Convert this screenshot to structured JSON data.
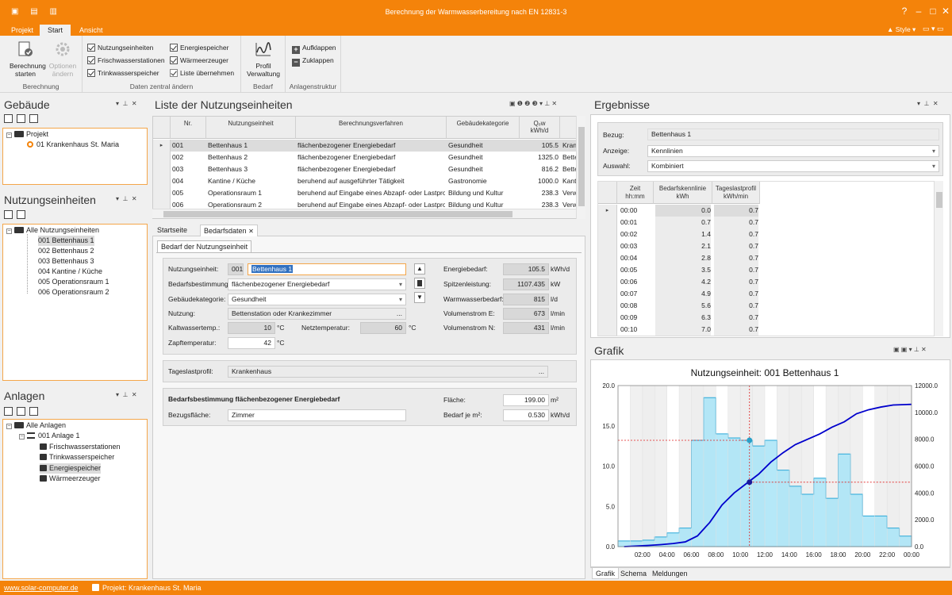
{
  "app": {
    "title": "Berechnung der Warmwasserbereitung nach EN 12831-3",
    "style_label": "Style"
  },
  "menu": {
    "tabs": [
      "Projekt",
      "Start",
      "Ansicht"
    ]
  },
  "ribbon": {
    "groups": [
      "Berechnung",
      "Daten zentral ändern",
      "Bedarf",
      "Anlagenstruktur"
    ],
    "berechnung_starten": "Berechnung starten",
    "optionen": "Optionen ändern",
    "daten_items": [
      "Nutzungseinheiten",
      "Frischwasserstationen",
      "Trinkwasserspeicher",
      "Energiespeicher",
      "Wärmeerzeuger",
      "Liste übernehmen"
    ],
    "profil": "Profil Verwaltung",
    "aufklappen": "Aufklappen",
    "zuklappen": "Zuklappen"
  },
  "gebaeude": {
    "title": "Gebäude",
    "tree": [
      "Projekt",
      "01 Krankenhaus St. Maria"
    ]
  },
  "nutzungseinheiten": {
    "title": "Nutzungseinheiten",
    "tree": [
      "Alle Nutzungseinheiten",
      "001 Bettenhaus 1",
      "002 Bettenhaus 2",
      "003 Bettenhaus 3",
      "004 Kantine / Küche",
      "005 Operationsraum 1",
      "006 Operationsraum 2"
    ]
  },
  "anlagen": {
    "title": "Anlagen",
    "tree": [
      "Alle Anlagen",
      "001 Anlage 1",
      "Frischwasserstationen",
      "Trinkwasserspeicher",
      "Energiespeicher",
      "Wärmeerzeuger"
    ]
  },
  "liste": {
    "title": "Liste der Nutzungseinheiten",
    "pager": [
      "1",
      "2",
      "3"
    ],
    "headers": [
      "Nr.",
      "Nutzungseinheit",
      "Berechnungsverfahren",
      "Gebäudekategorie",
      "Qₑw\nkWh/d"
    ],
    "rows": [
      [
        "001",
        "Bettenhaus 1",
        "flächenbezogener Energiebedarf",
        "Gesundheit",
        "105.5",
        "Krank"
      ],
      [
        "002",
        "Bettenhaus 2",
        "flächenbezogener Energiebedarf",
        "Gesundheit",
        "1325.0",
        "Bette"
      ],
      [
        "003",
        "Bettenhaus 3",
        "flächenbezogener Energiebedarf",
        "Gesundheit",
        "816.2",
        "Bette"
      ],
      [
        "004",
        "Kantine / Küche",
        "beruhend auf ausgeführter Tätigkeit",
        "Gastronomie",
        "1000.0",
        "Kanti"
      ],
      [
        "005",
        "Operationsraum 1",
        "beruhend auf Eingabe eines Abzapf- oder Lastprofils",
        "Bildung und Kultur",
        "238.3",
        "Verw"
      ],
      [
        "006",
        "Operationsraum 2",
        "beruhend auf Eingabe eines Abzapf- oder Lastprofils",
        "Bildung und Kultur",
        "238.3",
        "Verw"
      ]
    ]
  },
  "doc_tabs": [
    "Startseite",
    "Bedarfsdaten"
  ],
  "bedarf": {
    "subtab": "Bedarf der Nutzungseinheit",
    "nutzungseinheit_label": "Nutzungseinheit:",
    "nutzungseinheit_nr": "001",
    "nutzungseinheit_name": "Bettenhaus 1",
    "bedarfsbestimmung_label": "Bedarfsbestimmung:",
    "bedarfsbestimmung": "flächenbezogener Energiebedarf",
    "gebaeudekategorie_label": "Gebäudekategorie:",
    "gebaeudekategorie": "Gesundheit",
    "nutzung_label": "Nutzung:",
    "nutzung": "Bettenstation oder Krankezimmer",
    "kaltwasser_label": "Kaltwassertemp.:",
    "kaltwasser": "10",
    "netz_label": "Netztemperatur:",
    "netz": "60",
    "zapf_label": "Zapftemperatur:",
    "zapf": "42",
    "celsius": "°C",
    "energiebedarf_label": "Energiebedarf:",
    "energiebedarf": "105.5",
    "energiebedarf_unit": "kWh/d",
    "spitzen_label": "Spitzenleistung:",
    "spitzen": "1107.435",
    "spitzen_unit": "kW",
    "wwbedarf_label": "Warmwasserbedarf:",
    "wwbedarf": "815",
    "wwbedarf_unit": "l/d",
    "volE_label": "Volumenstrom E:",
    "volE": "673",
    "volN_label": "Volumenstrom N:",
    "volN": "431",
    "vol_unit": "l/min",
    "tageslast_label": "Tageslastprofil:",
    "tageslast": "Krankenhaus",
    "sect_title": "Bedarfsbestimmung flächenbezogener Energiebedarf",
    "bezug_label": "Bezugsfläche:",
    "bezug": "Zimmer",
    "flaeche_label": "Fläche:",
    "flaeche": "199.00",
    "flaeche_unit": "m²",
    "bedarfjem2_label": "Bedarf je m²:",
    "bedarfjem2": "0.530",
    "bedarfjem2_unit": "kWh/d"
  },
  "ergebnisse": {
    "title": "Ergebnisse",
    "bezug_label": "Bezug:",
    "bezug": "Bettenhaus 1",
    "anzeige_label": "Anzeige:",
    "anzeige": "Kennlinien",
    "auswahl_label": "Auswahl:",
    "auswahl": "Kombiniert",
    "headers": [
      "Zeit\nhh:mm",
      "Bedarfskennlinie\nkWh",
      "Tageslastprofil\nkWh/min"
    ],
    "rows": [
      [
        "00:00",
        "0.0",
        "0.7"
      ],
      [
        "00:01",
        "0.7",
        "0.7"
      ],
      [
        "00:02",
        "1.4",
        "0.7"
      ],
      [
        "00:03",
        "2.1",
        "0.7"
      ],
      [
        "00:04",
        "2.8",
        "0.7"
      ],
      [
        "00:05",
        "3.5",
        "0.7"
      ],
      [
        "00:06",
        "4.2",
        "0.7"
      ],
      [
        "00:07",
        "4.9",
        "0.7"
      ],
      [
        "00:08",
        "5.6",
        "0.7"
      ],
      [
        "00:09",
        "6.3",
        "0.7"
      ],
      [
        "00:10",
        "7.0",
        "0.7"
      ]
    ]
  },
  "grafik": {
    "title": "Grafik",
    "tabs": [
      "Grafik",
      "Schema",
      "Meldungen"
    ]
  },
  "chart_data": {
    "type": "area",
    "title": "Nutzungseinheit: 001 Bettenhaus 1",
    "x_ticks": [
      "02:00",
      "04:00",
      "06:00",
      "08:00",
      "10:00",
      "12:00",
      "14:00",
      "16:00",
      "18:00",
      "20:00",
      "22:00",
      "00:00"
    ],
    "y_left_ticks": [
      "0.0",
      "5.0",
      "10.0",
      "15.0",
      "20.0"
    ],
    "y_right_ticks": [
      "0.0",
      "2000.0",
      "4000.0",
      "6000.0",
      "8000.0",
      "10000.0",
      "12000.0"
    ],
    "ylim_left": [
      0,
      20
    ],
    "ylim_right": [
      0,
      12000
    ],
    "xlim_hours": [
      0,
      24
    ],
    "series": [
      {
        "values_hourly": [
          0.7,
          0.7,
          0.8,
          1.2,
          1.7,
          2.3,
          13.2,
          18.5,
          14,
          13.5,
          13.2,
          12.5,
          13.2,
          9.5,
          7.5,
          6.5,
          8.5,
          6,
          11.5,
          6.5,
          3.8,
          3.8,
          2.3,
          1.3
        ]
      },
      {
        "values_cumulative": [
          0,
          40,
          90,
          150,
          230,
          350,
          800,
          1800,
          3100,
          4000,
          4700,
          5400,
          6300,
          7000,
          7600,
          8000,
          8400,
          8900,
          9300,
          9900,
          10200,
          10400,
          10550,
          10600
        ]
      }
    ],
    "crosshair": {
      "x": "10:45",
      "y_left": 13.2,
      "y_right": 4800
    },
    "accent_color": "#0000cc",
    "fill_color": "#a8e4f7"
  },
  "status": {
    "link": "www.solar-computer.de",
    "projekt": "Projekt: Krankenhaus St. Maria"
  }
}
